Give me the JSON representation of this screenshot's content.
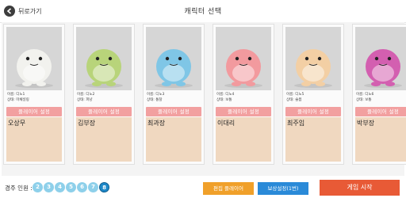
{
  "header": {
    "back_label": "뒤로가기",
    "title": "캐릭터 선택"
  },
  "cards": [
    {
      "line1": "이름: 디노1",
      "line2": "상태: 미채널링",
      "button": "플레이어 설정",
      "player": "오상무",
      "color": "#f2f2ee"
    },
    {
      "line1": "이름: 디노2",
      "line2": "상태: 피냥",
      "button": "플레이어 설정",
      "player": "김부장",
      "color": "#b8d47a"
    },
    {
      "line1": "이름: 디노3",
      "line2": "상태: 통찰",
      "button": "플레이어 설정",
      "player": "최과장",
      "color": "#7fc6e6"
    },
    {
      "line1": "이름: 디노4",
      "line2": "상태: 보통",
      "button": "플레이어 설정",
      "player": "이대리",
      "color": "#f29a9e"
    },
    {
      "line1": "이름: 디노5",
      "line2": "상태: 슬픔",
      "button": "플레이어 설정",
      "player": "최주임",
      "color": "#f3cfa4"
    },
    {
      "line1": "이름: 디노6",
      "line2": "상태: 보통",
      "button": "플레이어 설정",
      "player": "박부장",
      "color": "#d35fb0"
    }
  ],
  "footer": {
    "count_label": "경주 인원 :",
    "numbers": [
      "2",
      "3",
      "4",
      "5",
      "6",
      "7",
      "8"
    ],
    "selected_number": "8",
    "edit_button": "편집 플레이어",
    "reward_button": "보상설정(1번)",
    "start_button": "게임 시작"
  }
}
